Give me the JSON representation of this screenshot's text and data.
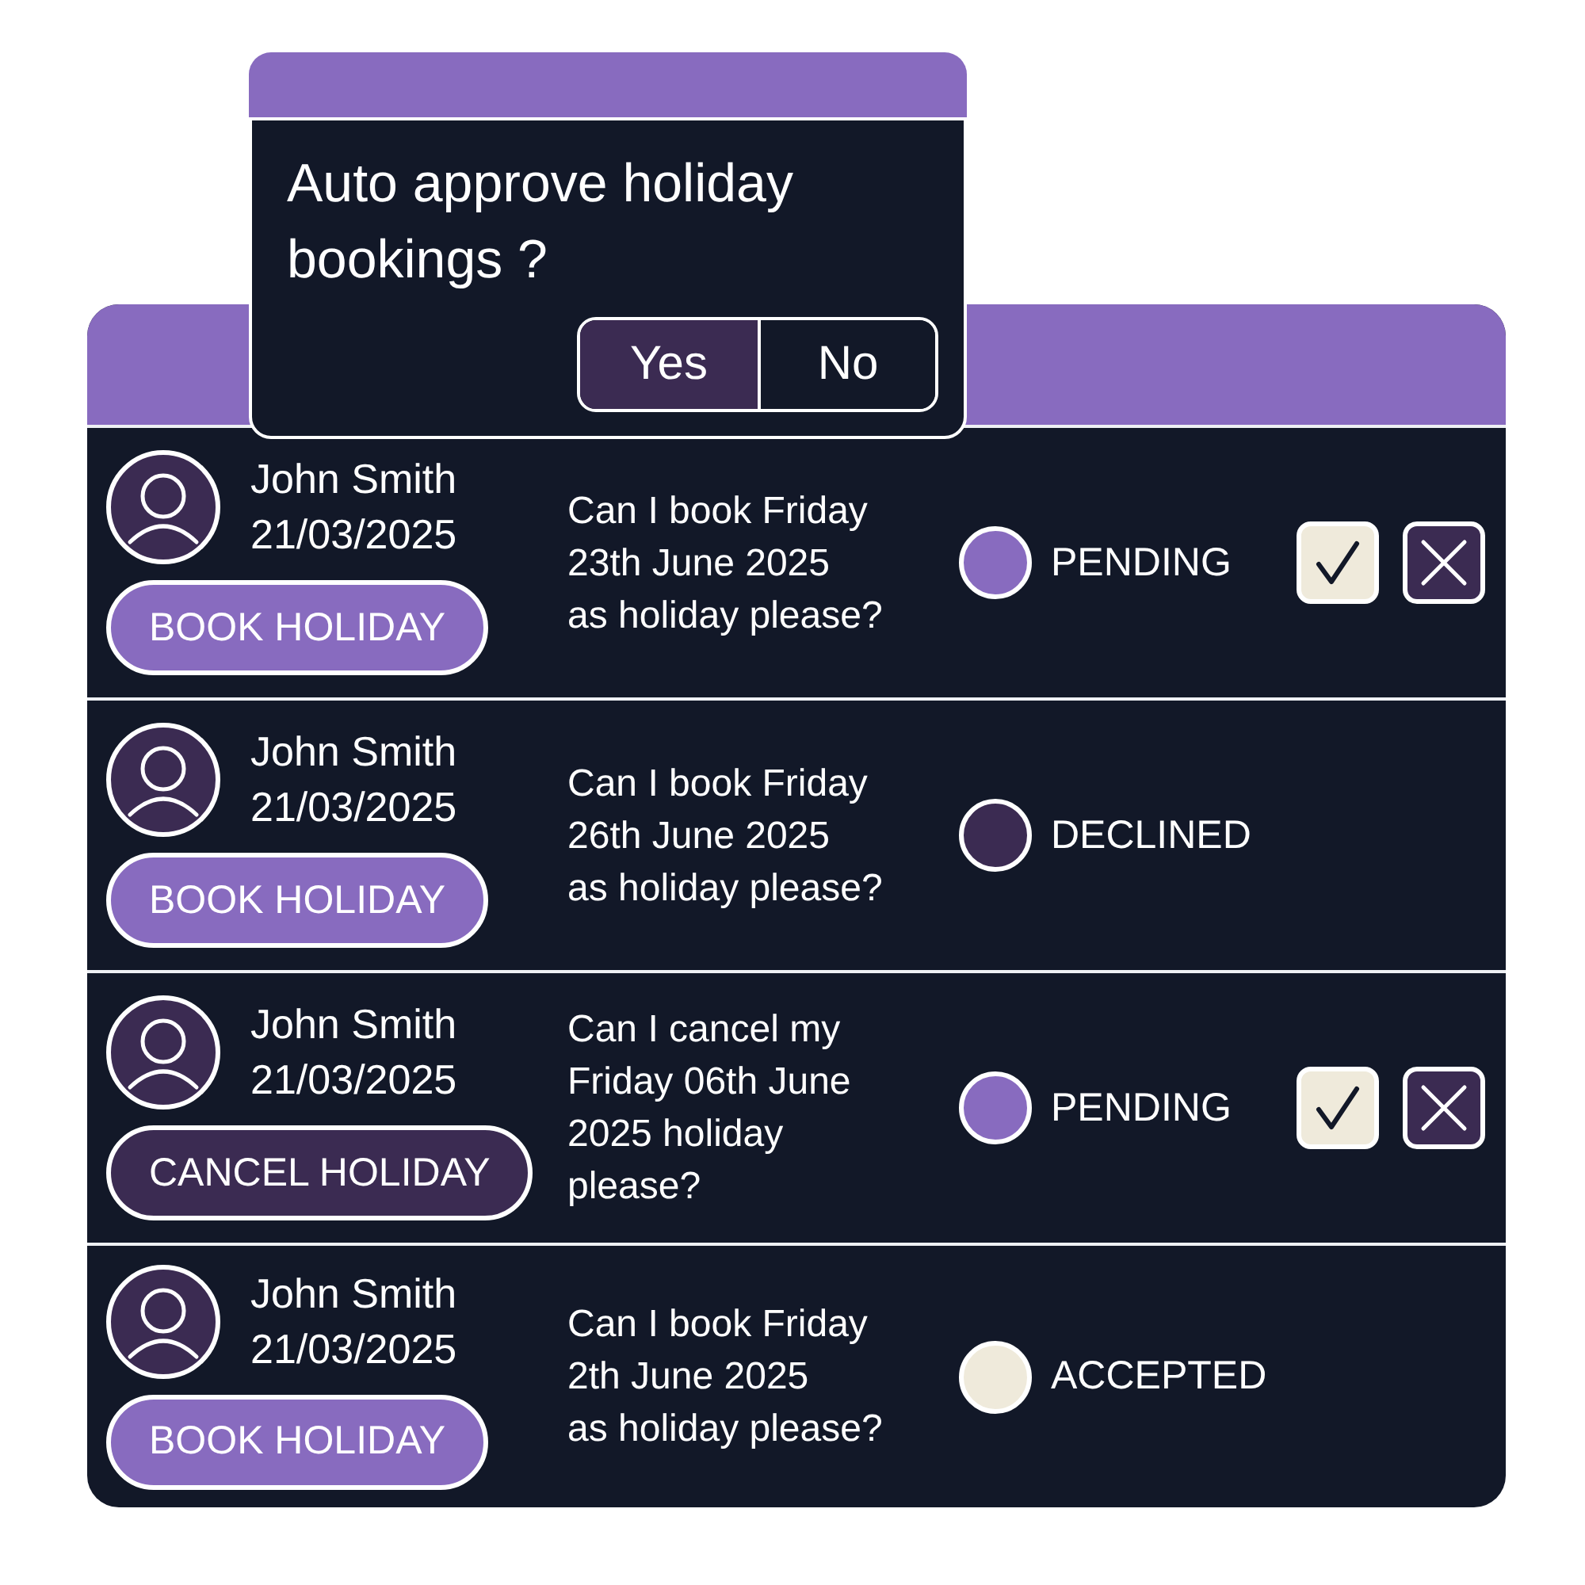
{
  "dialog": {
    "question": "Auto approve holiday bookings ?",
    "options": [
      {
        "label": "Yes",
        "selected": true
      },
      {
        "label": "No",
        "selected": false
      }
    ]
  },
  "requests": [
    {
      "name": "John Smith",
      "date": "21/03/2025",
      "action": {
        "kind": "book",
        "label": "BOOK HOLIDAY"
      },
      "message": "Can I book Friday\n23th June 2025\nas holiday please?",
      "status": {
        "label": "PENDING",
        "color": "#886bbf"
      },
      "review_buttons": true
    },
    {
      "name": "John Smith",
      "date": "21/03/2025",
      "action": {
        "kind": "book",
        "label": "BOOK HOLIDAY"
      },
      "message": "Can I book Friday\n26th June 2025\nas holiday please?",
      "status": {
        "label": "DECLINED",
        "color": "#3b2b52"
      },
      "review_buttons": false
    },
    {
      "name": "John Smith",
      "date": "21/03/2025",
      "action": {
        "kind": "cancel",
        "label": "CANCEL HOLIDAY"
      },
      "message": "Can I cancel my\nFriday 06th June\n2025 holiday\nplease?",
      "status": {
        "label": "PENDING",
        "color": "#886bbf"
      },
      "review_buttons": true
    },
    {
      "name": "John Smith",
      "date": "21/03/2025",
      "action": {
        "kind": "book",
        "label": "BOOK HOLIDAY"
      },
      "message": "Can I book Friday\n2th June 2025\nas holiday please?",
      "status": {
        "label": "ACCEPTED",
        "color": "#efeadb"
      },
      "review_buttons": false
    }
  ]
}
